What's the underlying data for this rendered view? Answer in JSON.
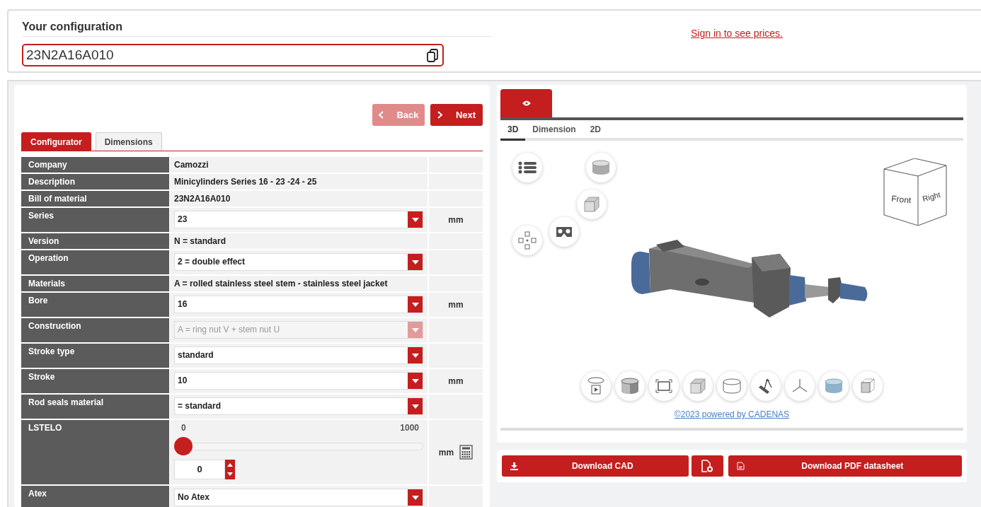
{
  "header": {
    "title": "Your configuration",
    "code": "23N2A16A010",
    "sign_in_link": "Sign in to see prices."
  },
  "nav": [
    {
      "kind": "back",
      "label": "Back",
      "disabled": true
    },
    {
      "kind": "next",
      "label": "Next",
      "disabled": false
    }
  ],
  "tabs": [
    {
      "label": "Configurator",
      "selected": true
    },
    {
      "label": "Dimensions",
      "selected": false
    }
  ],
  "rows": [
    {
      "kind": "text",
      "label": "Company",
      "value": "Camozzi"
    },
    {
      "kind": "text",
      "label": "Description",
      "value": "Minicylinders Series 16 - 23 -24 - 25"
    },
    {
      "kind": "text",
      "label": "Bill of material",
      "value": "23N2A16A010"
    },
    {
      "kind": "select",
      "label": "Series",
      "value": "23",
      "disabled": false,
      "unit": "mm"
    },
    {
      "kind": "text",
      "label": "Version",
      "value": "N = standard"
    },
    {
      "kind": "select",
      "label": "Operation",
      "value": "2 = double effect",
      "disabled": false
    },
    {
      "kind": "text",
      "label": "Materials",
      "value": "A = rolled stainless steel stem - stainless steel jacket"
    },
    {
      "kind": "select",
      "label": "Bore",
      "value": "16",
      "disabled": false,
      "unit": "mm"
    },
    {
      "kind": "select",
      "label": "Construction",
      "value": "A = ring nut V + stem nut U",
      "disabled": true
    },
    {
      "kind": "select",
      "label": "Stroke type",
      "value": "standard",
      "disabled": false
    },
    {
      "kind": "select",
      "label": "Stroke",
      "value": "10",
      "disabled": false,
      "unit": "mm"
    },
    {
      "kind": "select",
      "label": "Rod seals material",
      "value": "= standard",
      "disabled": false
    },
    {
      "kind": "slider",
      "label": "LSTELO",
      "min": "0",
      "max": "1000",
      "level": 0,
      "value": "0",
      "unit": "mm"
    },
    {
      "kind": "select",
      "label": "Atex",
      "value": "No Atex",
      "disabled": false
    }
  ],
  "viewer": {
    "view_tabs": [
      {
        "kind": "eye",
        "selected": true
      }
    ],
    "sub_tabs": [
      {
        "label": "3D",
        "selected": true
      },
      {
        "label": "Dimension",
        "selected": false
      },
      {
        "label": "2D",
        "selected": false
      }
    ],
    "cube": {
      "front": "Front",
      "right": "Right"
    },
    "credit": "©2023 powered by CADENAS"
  },
  "actions": [
    {
      "kind": "download",
      "label": "Download CAD"
    },
    {
      "kind": "settings"
    },
    {
      "kind": "pdf",
      "label": "Download PDF datasheet"
    }
  ]
}
